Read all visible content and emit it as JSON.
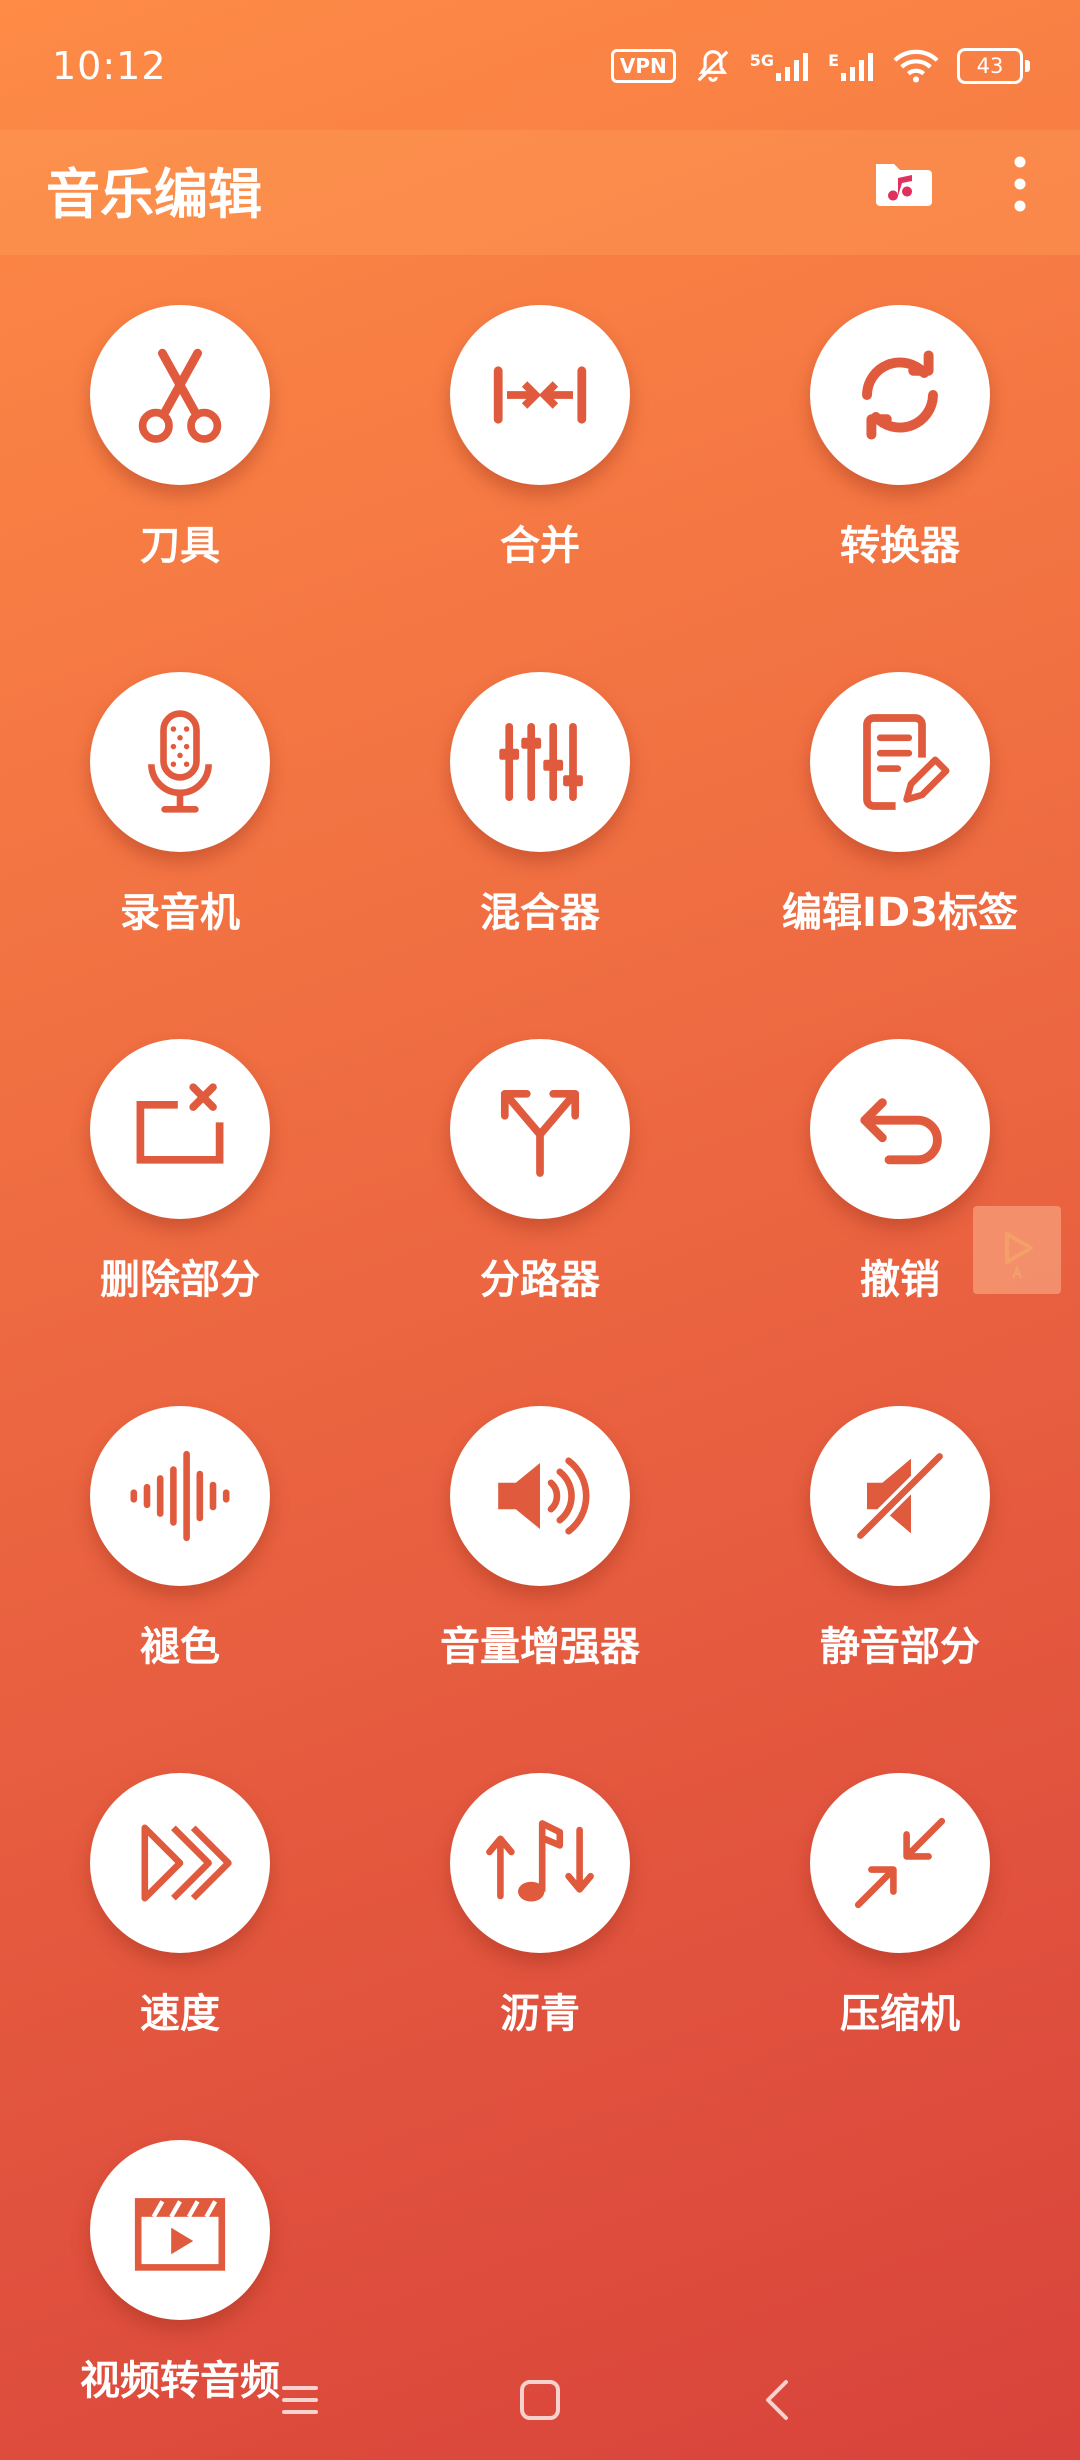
{
  "status_bar": {
    "time": "10:12",
    "vpn": "VPN",
    "network_5g": "5G",
    "network_e": "E",
    "battery": "43"
  },
  "app_bar": {
    "title": "音乐编辑",
    "folder_icon": "music-folder-icon",
    "menu_icon": "more-vert-icon"
  },
  "tools": [
    {
      "label": "刀具",
      "icon": "scissors-icon"
    },
    {
      "label": "合并",
      "icon": "merge-icon"
    },
    {
      "label": "转换器",
      "icon": "sync-icon"
    },
    {
      "label": "录音机",
      "icon": "microphone-icon"
    },
    {
      "label": "混合器",
      "icon": "sliders-icon"
    },
    {
      "label": "编辑ID3标签",
      "icon": "edit-document-icon"
    },
    {
      "label": "删除部分",
      "icon": "remove-part-icon"
    },
    {
      "label": "分路器",
      "icon": "split-icon"
    },
    {
      "label": "撤销",
      "icon": "undo-icon"
    },
    {
      "label": "褪色",
      "icon": "waveform-icon"
    },
    {
      "label": "音量增强器",
      "icon": "volume-up-icon"
    },
    {
      "label": "静音部分",
      "icon": "mute-icon"
    },
    {
      "label": "速度",
      "icon": "fast-forward-icon"
    },
    {
      "label": "沥青",
      "icon": "pitch-icon"
    },
    {
      "label": "压缩机",
      "icon": "compress-icon"
    },
    {
      "label": "视频转音频",
      "icon": "video-clapper-icon"
    }
  ],
  "colors": {
    "accent": "#E05A3D",
    "background_top": "#FE8B46",
    "background_bottom": "#D8433B"
  }
}
